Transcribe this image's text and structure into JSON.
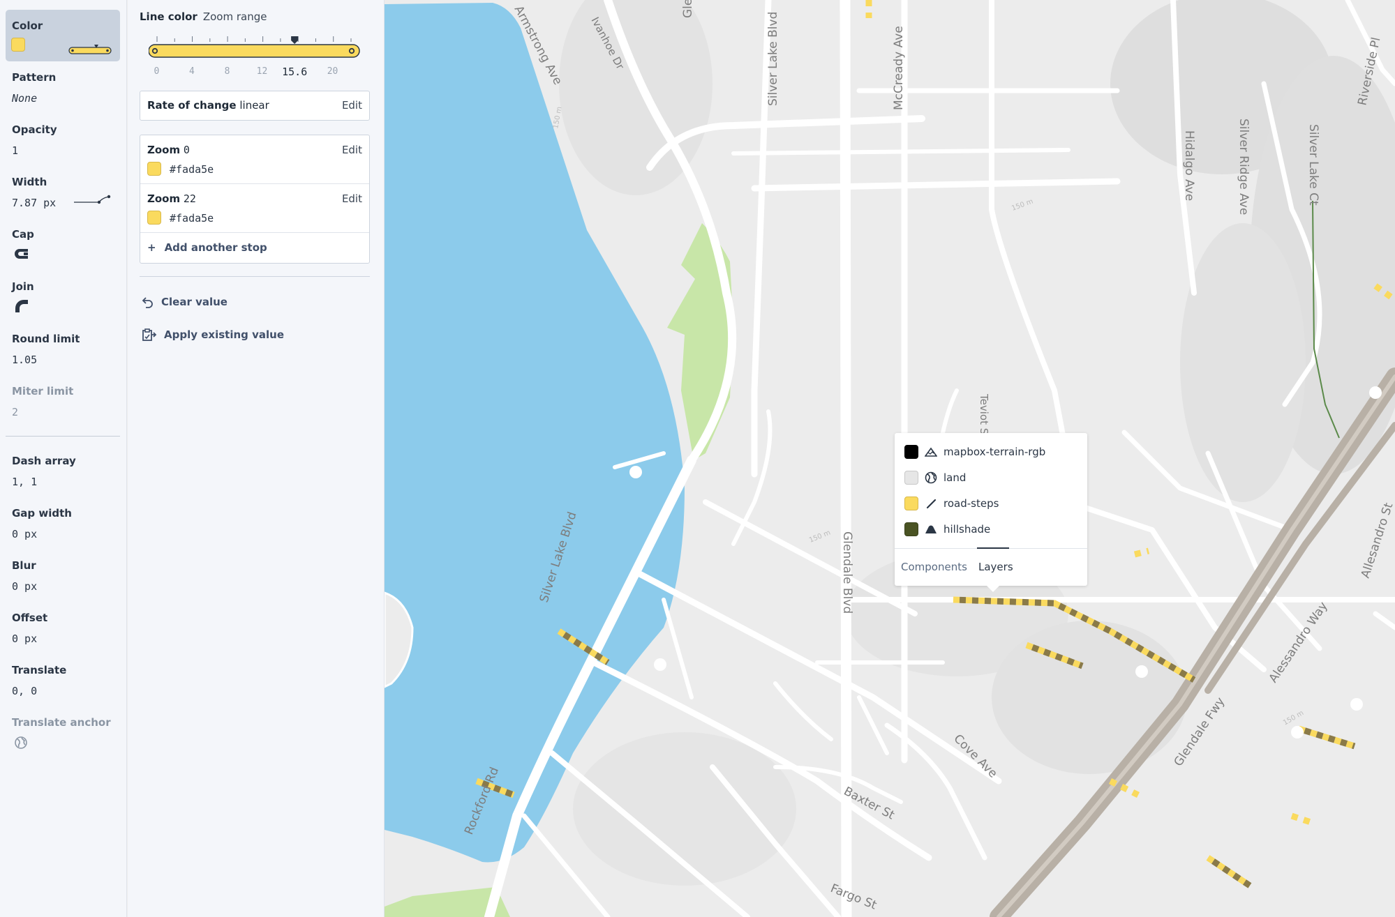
{
  "properties": [
    {
      "id": "color",
      "label": "Color",
      "value": "",
      "active": true
    },
    {
      "id": "pattern",
      "label": "Pattern",
      "value": "None"
    },
    {
      "id": "opacity",
      "label": "Opacity",
      "value": "1"
    },
    {
      "id": "width",
      "label": "Width",
      "value": "7.87 px"
    },
    {
      "id": "cap",
      "label": "Cap",
      "value": ""
    },
    {
      "id": "join",
      "label": "Join",
      "value": ""
    },
    {
      "id": "round_limit",
      "label": "Round limit",
      "value": "1.05"
    },
    {
      "id": "miter_limit",
      "label": "Miter limit",
      "value": "2"
    },
    {
      "id": "dash_array",
      "label": "Dash array",
      "value": "1, 1"
    },
    {
      "id": "gap_width",
      "label": "Gap width",
      "value": "0 px"
    },
    {
      "id": "blur",
      "label": "Blur",
      "value": "0 px"
    },
    {
      "id": "offset",
      "label": "Offset",
      "value": "0 px"
    },
    {
      "id": "translate",
      "label": "Translate",
      "value": "0, 0"
    },
    {
      "id": "translate_anchor",
      "label": "Translate anchor",
      "value": ""
    }
  ],
  "editor": {
    "title": "Line color",
    "mode": "Zoom range",
    "slider": {
      "ticks": [
        "0",
        "4",
        "8",
        "12",
        "15.6",
        "20"
      ],
      "value": 15.6,
      "min": 0,
      "max": 22
    },
    "rate_label": "Rate of change",
    "rate_value": "linear",
    "edit_label": "Edit",
    "stops": [
      {
        "label": "Zoom",
        "zoom": "0",
        "color": "#fada5e"
      },
      {
        "label": "Zoom",
        "zoom": "22",
        "color": "#fada5e"
      }
    ],
    "add_stop": "Add another stop",
    "clear_value": "Clear value",
    "apply_existing": "Apply existing value"
  },
  "popup": {
    "layers": [
      {
        "name": "mapbox-terrain-rgb",
        "color": "#000000",
        "icon": "mountain-icon"
      },
      {
        "name": "land",
        "color": "#e6e6e6",
        "icon": "globe-icon"
      },
      {
        "name": "road-steps",
        "color": "#fada5e",
        "icon": "line-icon"
      },
      {
        "name": "hillshade",
        "color": "#4a5323",
        "icon": "hillshade-icon"
      }
    ],
    "tabs": [
      "Components",
      "Layers"
    ],
    "selected_tab": "Layers"
  },
  "map": {
    "labels": [
      "Armstrong Ave",
      "Ivanhoe Dr",
      "Glendale Blvd",
      "Silver Lake Blvd",
      "McCready Ave",
      "Hidalgo Ave",
      "Silver Ridge Ave",
      "Silver Lake Ct",
      "Riverside Pl",
      "Teviot St",
      "Alessandro Way",
      "Allesandro St",
      "Glendale Fwy",
      "Cove Ave",
      "Baxter St",
      "Rockford Rd",
      "Fargo St",
      "150 m",
      "150 m",
      "150 m",
      "150 m"
    ],
    "colors": {
      "water": "#8ccbeb",
      "park": "#c8e6a8",
      "road": "#ffffff",
      "freeway": "#b8b0a6",
      "steps": "#fada5e"
    }
  }
}
